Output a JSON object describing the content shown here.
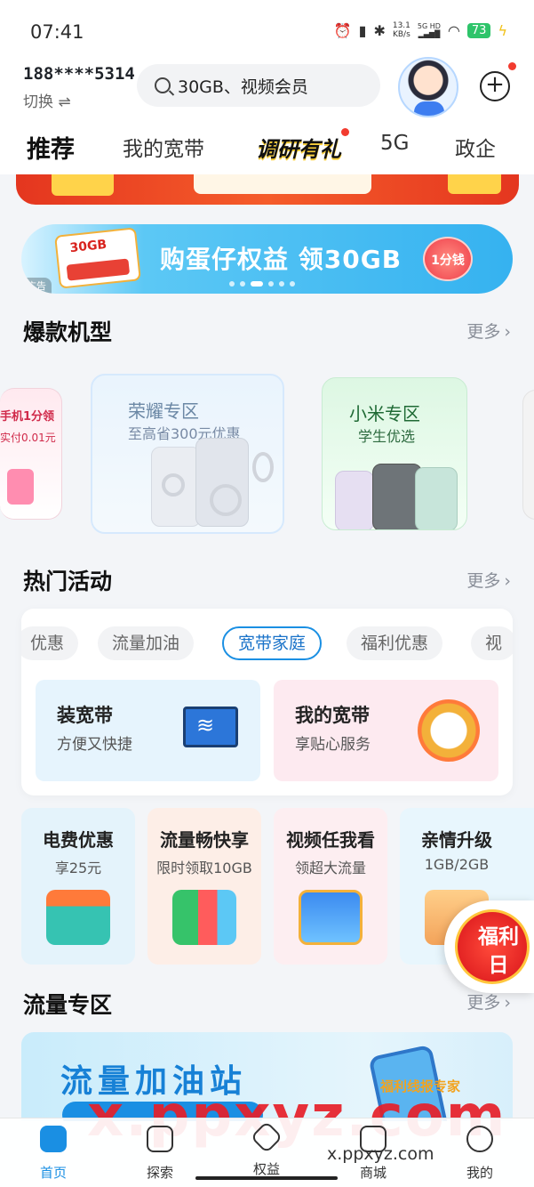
{
  "status_bar": {
    "time": "07:41",
    "net_speed": "13.1",
    "net_unit": "KB/s",
    "net_type": "5G HD",
    "battery": "73",
    "icons": [
      "alarm-icon",
      "vibrate-icon",
      "bluetooth-icon",
      "signal-icon",
      "wifi-icon",
      "charging-icon"
    ]
  },
  "header": {
    "phone": "188****5314",
    "switch_label": "切换 ⇌",
    "search_placeholder": "30GB、视频会员",
    "add_symbol": "+"
  },
  "tabs": [
    "推荐",
    "我的宽带",
    "调研有礼",
    "5G",
    "政企"
  ],
  "ad_banner": {
    "text": "购蛋仔权益 领30GB",
    "button": "1分钱",
    "gift_label": "30GB",
    "tag": "广告"
  },
  "hot_models": {
    "title": "爆款机型",
    "more": "更多",
    "left_card": {
      "title": "手机1分领",
      "sub": "实付0.01元"
    },
    "honor": {
      "title": "荣耀专区",
      "sub": "至高省300元优惠"
    },
    "xiaomi": {
      "title": "小米专区",
      "sub": "学生优选"
    }
  },
  "hot_activities": {
    "title": "热门活动",
    "more": "更多",
    "chips": [
      "优惠",
      "流量加油",
      "宽带家庭",
      "福利优惠",
      "视"
    ],
    "active_chip": "宽带家庭",
    "tiles": [
      {
        "title": "装宽带",
        "sub": "方便又快捷"
      },
      {
        "title": "我的宽带",
        "sub": "享贴心服务"
      }
    ]
  },
  "promos": [
    {
      "title": "电费优惠",
      "sub": "享25元"
    },
    {
      "title": "流量畅快享",
      "sub": "限时领取10GB"
    },
    {
      "title": "视频任我看",
      "sub": "领超大流量"
    },
    {
      "title": "亲情升级",
      "sub": "1GB/2GB"
    }
  ],
  "welfare": {
    "line1": "福利",
    "line2": "日"
  },
  "data_zone": {
    "title": "流量专区",
    "more": "更多",
    "banner_text": "流量加油站"
  },
  "watermark": {
    "big": "x.ppxyz.com",
    "small": "x.ppxyz.com",
    "tag": "福利线报专家"
  },
  "bottom_nav": [
    {
      "label": "首页",
      "icon": "home-icon"
    },
    {
      "label": "探索",
      "icon": "explore-icon"
    },
    {
      "label": "权益",
      "icon": "benefits-icon"
    },
    {
      "label": "商城",
      "icon": "mall-icon"
    },
    {
      "label": "我的",
      "icon": "profile-icon"
    }
  ],
  "colors": {
    "accent": "#1a8fe3",
    "red": "#f23b2f"
  }
}
